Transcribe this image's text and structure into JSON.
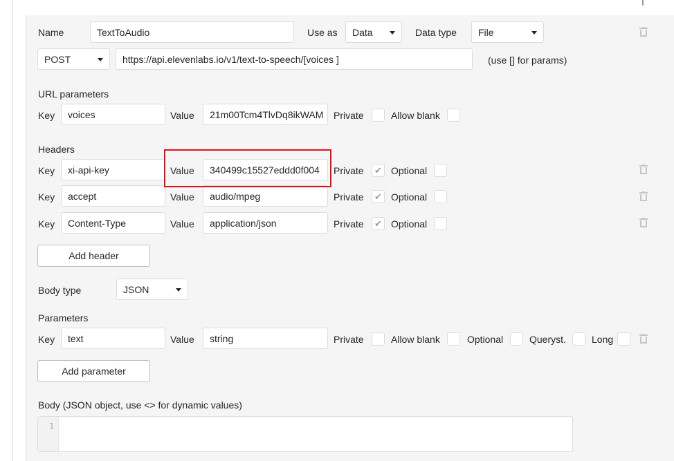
{
  "call": {
    "name_label": "Name",
    "name_value": "TextToAudio",
    "use_as_label": "Use as",
    "use_as_value": "Data",
    "data_type_label": "Data type",
    "data_type_value": "File",
    "method": "POST",
    "url": "https://api.elevenlabs.io/v1/text-to-speech/[voices ]",
    "url_hint": "(use [] for params)"
  },
  "url_parameters": {
    "title": "URL parameters",
    "rows": [
      {
        "key_label": "Key",
        "key": "voices",
        "value_label": "Value",
        "value": "21m00Tcm4TlvDq8ikWAM",
        "private_label": "Private",
        "private": false,
        "blank_label": "Allow blank",
        "allow_blank": false
      }
    ]
  },
  "headers": {
    "title": "Headers",
    "rows": [
      {
        "key_label": "Key",
        "key": "xi-api-key",
        "value_label": "Value",
        "value": "340499c15527eddd0f004",
        "private_label": "Private",
        "private": true,
        "optional_label": "Optional",
        "optional": false
      },
      {
        "key_label": "Key",
        "key": "accept",
        "value_label": "Value",
        "value": "audio/mpeg",
        "private_label": "Private",
        "private": true,
        "optional_label": "Optional",
        "optional": false
      },
      {
        "key_label": "Key",
        "key": "Content-Type",
        "value_label": "Value",
        "value": "application/json",
        "private_label": "Private",
        "private": true,
        "optional_label": "Optional",
        "optional": false
      }
    ],
    "add_button": "Add header"
  },
  "body": {
    "type_label": "Body type",
    "type_value": "JSON"
  },
  "parameters": {
    "title": "Parameters",
    "rows": [
      {
        "key_label": "Key",
        "key": "text",
        "value_label": "Value",
        "value": "string",
        "private_label": "Private",
        "blank_label": "Allow blank",
        "optional_label": "Optional",
        "queryst_label": "Queryst.",
        "long_label": "Long"
      }
    ],
    "add_button": "Add parameter"
  },
  "body_editor": {
    "label": "Body (JSON object, use <> for dynamic values)",
    "line_number": "1"
  },
  "icons": {
    "delete": "trash-icon",
    "checked": "checkmark-icon",
    "dropdown": "caret-down-icon"
  },
  "colors": {
    "highlight": "#e0101a",
    "panel": "#f5f5f5",
    "check": "#9a9a9a"
  }
}
